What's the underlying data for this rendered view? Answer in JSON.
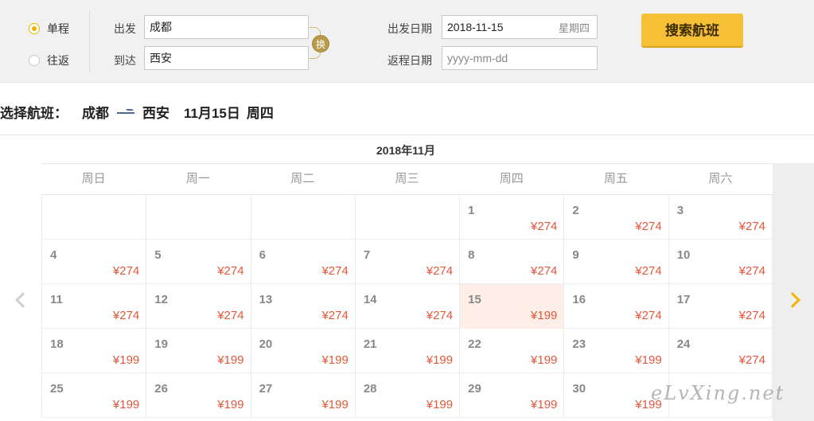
{
  "search": {
    "trip_types": [
      {
        "label": "单程",
        "checked": true
      },
      {
        "label": "往返",
        "checked": false
      }
    ],
    "from_label": "出发",
    "from_value": "成都",
    "to_label": "到达",
    "to_value": "西安",
    "swap_label": "换",
    "depart_date_label": "出发日期",
    "depart_date_value": "2018-11-15",
    "depart_weekday": "星期四",
    "return_date_label": "返程日期",
    "return_date_placeholder": "yyyy-mm-dd",
    "search_button": "搜索航班"
  },
  "selection": {
    "prefix": "选择航班：",
    "from": "成都",
    "to": "西安",
    "date": "11月15日",
    "weekday": "周四"
  },
  "calendar": {
    "month": "2018年11月",
    "weekdays": [
      "周日",
      "周一",
      "周二",
      "周三",
      "周四",
      "周五",
      "周六"
    ],
    "selected_day": "15",
    "rows": [
      [
        {
          "day": "",
          "price": ""
        },
        {
          "day": "",
          "price": ""
        },
        {
          "day": "",
          "price": ""
        },
        {
          "day": "",
          "price": ""
        },
        {
          "day": "1",
          "price": "¥274"
        },
        {
          "day": "2",
          "price": "¥274"
        },
        {
          "day": "3",
          "price": "¥274"
        }
      ],
      [
        {
          "day": "4",
          "price": "¥274"
        },
        {
          "day": "5",
          "price": "¥274"
        },
        {
          "day": "6",
          "price": "¥274"
        },
        {
          "day": "7",
          "price": "¥274"
        },
        {
          "day": "8",
          "price": "¥274"
        },
        {
          "day": "9",
          "price": "¥274"
        },
        {
          "day": "10",
          "price": "¥274"
        }
      ],
      [
        {
          "day": "11",
          "price": "¥274"
        },
        {
          "day": "12",
          "price": "¥274"
        },
        {
          "day": "13",
          "price": "¥274"
        },
        {
          "day": "14",
          "price": "¥274"
        },
        {
          "day": "15",
          "price": "¥199"
        },
        {
          "day": "16",
          "price": "¥274"
        },
        {
          "day": "17",
          "price": "¥274"
        }
      ],
      [
        {
          "day": "18",
          "price": "¥199"
        },
        {
          "day": "19",
          "price": "¥199"
        },
        {
          "day": "20",
          "price": "¥199"
        },
        {
          "day": "21",
          "price": "¥199"
        },
        {
          "day": "22",
          "price": "¥199"
        },
        {
          "day": "23",
          "price": "¥199"
        },
        {
          "day": "24",
          "price": "¥274"
        }
      ],
      [
        {
          "day": "25",
          "price": "¥199"
        },
        {
          "day": "26",
          "price": "¥199"
        },
        {
          "day": "27",
          "price": "¥199"
        },
        {
          "day": "28",
          "price": "¥199"
        },
        {
          "day": "29",
          "price": "¥199"
        },
        {
          "day": "30",
          "price": "¥199"
        },
        {
          "day": "",
          "price": ""
        }
      ]
    ]
  },
  "icons": {
    "prev": "chevron-left-icon",
    "next": "chevron-right-icon"
  },
  "colors": {
    "accent": "#f6c137",
    "price": "#e4573a",
    "selected_bg": "#fdeee8"
  },
  "watermark": "eLvXing.net"
}
